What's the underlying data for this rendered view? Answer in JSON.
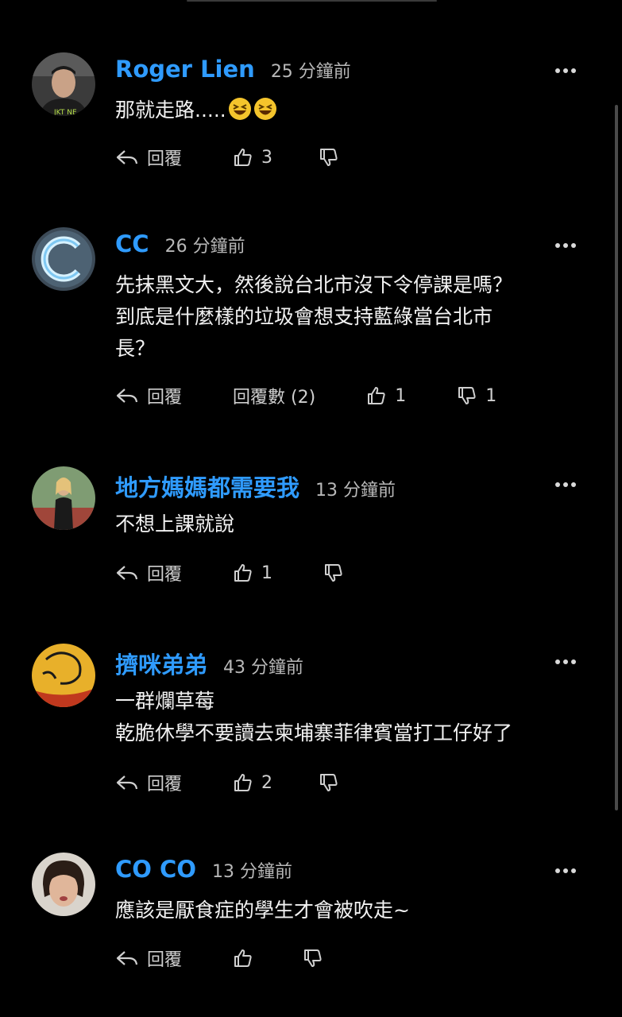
{
  "labels": {
    "reply": "回覆"
  },
  "colors": {
    "name": "#2f9bff",
    "background": "#000000"
  },
  "comments": [
    {
      "name": "Roger Lien",
      "time": "25 分鐘前",
      "text": "那就走路.....",
      "emoji": [
        "laughing-face-icon",
        "laughing-face-icon"
      ],
      "likes": "3",
      "dislikes": "",
      "replies": ""
    },
    {
      "name": "CC",
      "time": "26 分鐘前",
      "text": "先抹黑文大，然後說台北市沒下令停課是嗎？\n到底是什麼樣的垃圾會想支持藍綠當台北市\n長？",
      "likes": "1",
      "dislikes": "1",
      "replies": "回覆數 (2)"
    },
    {
      "name": "地方媽媽都需要我",
      "time": "13 分鐘前",
      "text": "不想上課就說",
      "likes": "1",
      "dislikes": "",
      "replies": ""
    },
    {
      "name": "擠咪弟弟",
      "time": "43 分鐘前",
      "text": "一群爛草莓\n乾脆休學不要讀去柬埔寨菲律賓當打工仔好了",
      "likes": "2",
      "dislikes": "",
      "replies": ""
    },
    {
      "name": "CO CO",
      "time": "13 分鐘前",
      "text": "應該是厭食症的學生才會被吹走~",
      "likes": "",
      "dislikes": "",
      "replies": ""
    }
  ]
}
